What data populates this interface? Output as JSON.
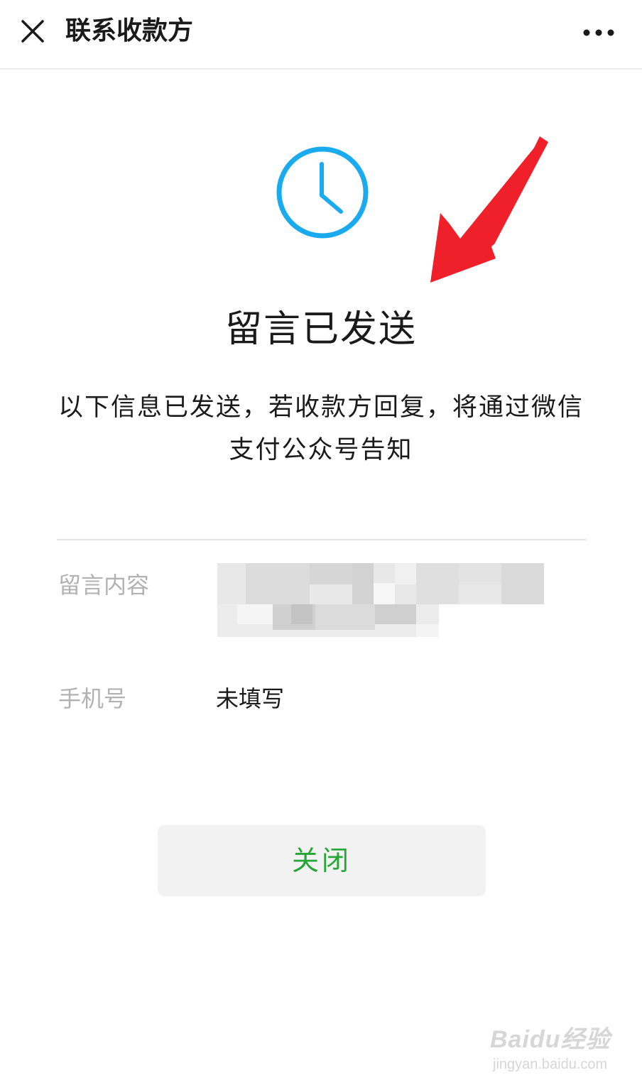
{
  "header": {
    "title": "联系收款方",
    "close_icon": "close-icon",
    "more_icon": "more-dots-icon"
  },
  "status": {
    "icon": "clock-icon",
    "accent_color": "#1aabef",
    "title": "留言已发送",
    "description": "以下信息已发送，若收款方回复，将通过微信支付公众号告知"
  },
  "fields": {
    "message_label": "留言内容",
    "phone_label": "手机号",
    "phone_value": "未填写"
  },
  "actions": {
    "close_label": "关闭",
    "close_color": "#26a637"
  },
  "annotation": {
    "arrow_color": "#f0202a"
  },
  "watermark": {
    "logo_text": "Baidu经验",
    "url": "jingyan.baidu.com"
  }
}
